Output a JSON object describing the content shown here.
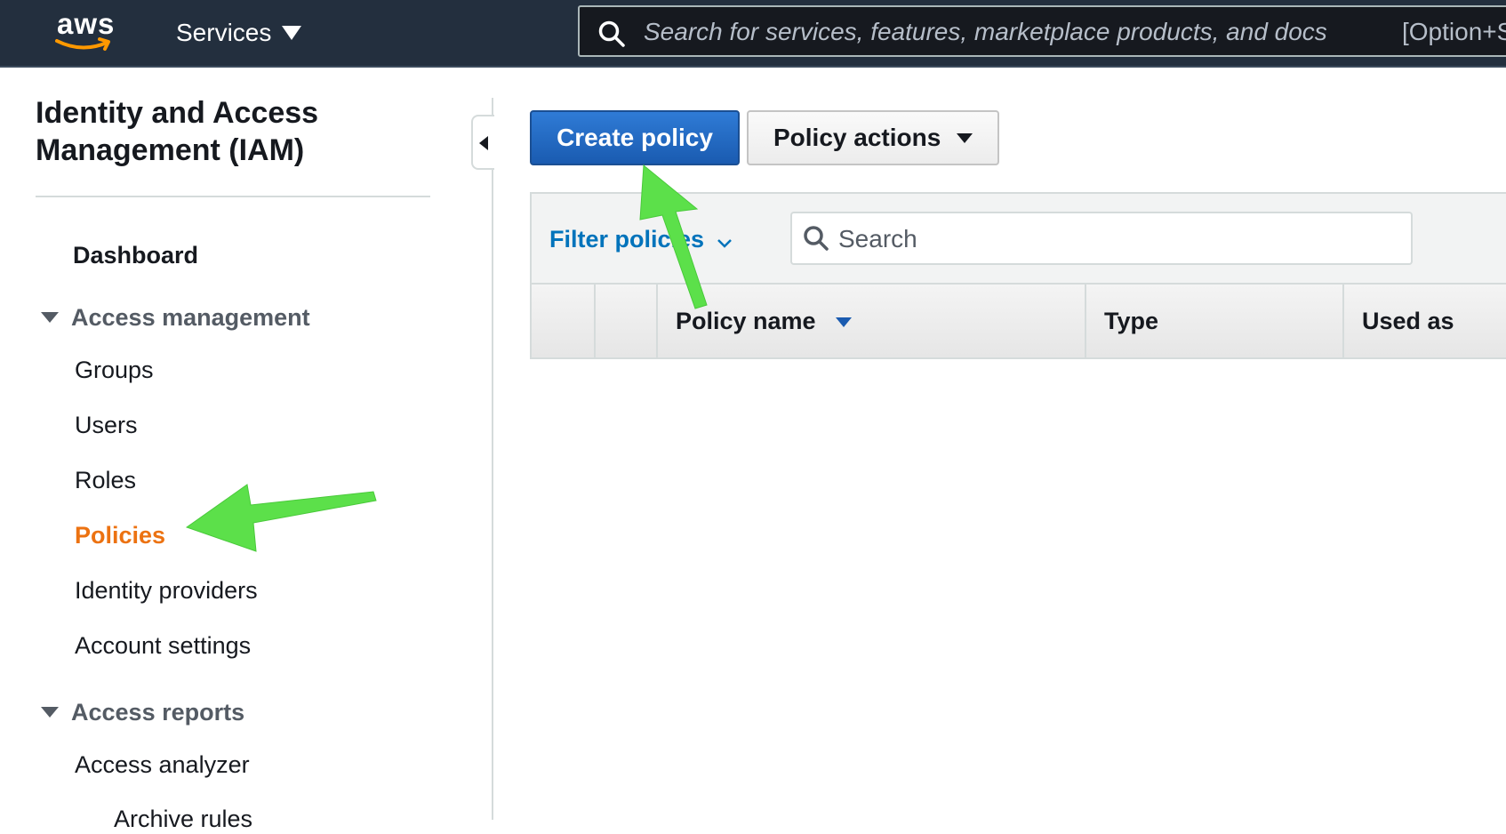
{
  "topnav": {
    "logo_text": "aws",
    "services_label": "Services",
    "search_placeholder": "Search for services, features, marketplace products, and docs",
    "search_shortcut": "[Option+S]"
  },
  "sidebar": {
    "title": "Identity and Access Management (IAM)",
    "dashboard_label": "Dashboard",
    "sections": [
      {
        "label": "Access management",
        "items": [
          "Groups",
          "Users",
          "Roles",
          "Policies",
          "Identity providers",
          "Account settings"
        ]
      },
      {
        "label": "Access reports",
        "items": [
          "Access analyzer",
          "Archive rules"
        ]
      }
    ],
    "active_item": "Policies"
  },
  "toolbar": {
    "create_label": "Create policy",
    "actions_label": "Policy actions"
  },
  "table": {
    "filter_label": "Filter policies",
    "search_placeholder": "Search",
    "columns": [
      "Policy name",
      "Type",
      "Used as"
    ]
  },
  "colors": {
    "nav_bg": "#232f3e",
    "primary_button": "#1a5bb0",
    "active_nav": "#ec7211",
    "link": "#0073bb",
    "annotation_arrow": "#5ce04a"
  }
}
